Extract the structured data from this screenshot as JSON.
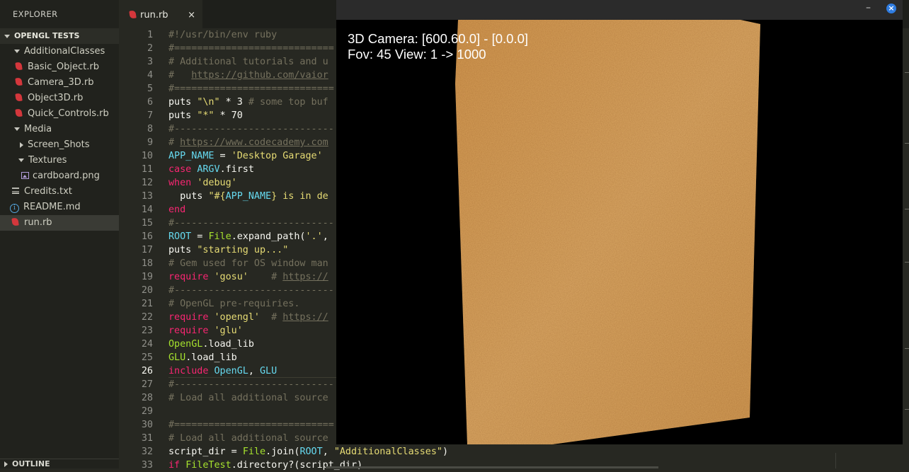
{
  "sidebar": {
    "header": "EXPLORER",
    "project": "OPENGL TESTS",
    "outline": "OUTLINE",
    "items": [
      {
        "label": "AdditionalClasses",
        "kind": "folder-open"
      },
      {
        "label": "Basic_Object.rb",
        "kind": "ruby"
      },
      {
        "label": "Camera_3D.rb",
        "kind": "ruby"
      },
      {
        "label": "Object3D.rb",
        "kind": "ruby"
      },
      {
        "label": "Quick_Controls.rb",
        "kind": "ruby"
      },
      {
        "label": "Media",
        "kind": "folder-open"
      },
      {
        "label": "Screen_Shots",
        "kind": "folder-closed"
      },
      {
        "label": "Textures",
        "kind": "folder-open"
      },
      {
        "label": "cardboard.png",
        "kind": "image"
      },
      {
        "label": "Credits.txt",
        "kind": "text"
      },
      {
        "label": "README.md",
        "kind": "info"
      },
      {
        "label": "run.rb",
        "kind": "ruby",
        "selected": true
      }
    ]
  },
  "tab": {
    "label": "run.rb",
    "close": "×"
  },
  "editor": {
    "line_numbers": [
      "1",
      "2",
      "3",
      "4",
      "5",
      "6",
      "7",
      "8",
      "9",
      "10",
      "11",
      "12",
      "13",
      "14",
      "15",
      "16",
      "17",
      "18",
      "19",
      "20",
      "21",
      "22",
      "23",
      "24",
      "25",
      "26",
      "27",
      "28",
      "29",
      "30",
      "31",
      "32",
      "33"
    ],
    "active_line": "26",
    "lines": [
      [
        [
          "c-com",
          "#!/usr/bin/env ruby"
        ]
      ],
      [
        [
          "c-com",
          "#============================"
        ]
      ],
      [
        [
          "c-com",
          "# Additional tutorials and u"
        ]
      ],
      [
        [
          "c-com",
          "#   "
        ],
        [
          "c-link",
          "https://github.com/vaior"
        ]
      ],
      [
        [
          "c-com",
          "#============================"
        ]
      ],
      [
        [
          "c-pl",
          "puts "
        ],
        [
          "c-str",
          "\"\\n\""
        ],
        [
          "c-pl",
          " * 3 "
        ],
        [
          "c-com",
          "# some top buf"
        ]
      ],
      [
        [
          "c-pl",
          "puts "
        ],
        [
          "c-str",
          "\"*\""
        ],
        [
          "c-pl",
          " * 70"
        ]
      ],
      [
        [
          "c-com",
          "#----------------------------"
        ]
      ],
      [
        [
          "c-com",
          "# "
        ],
        [
          "c-link",
          "https://www.codecademy.com"
        ]
      ],
      [
        [
          "c-const",
          "APP_NAME"
        ],
        [
          "c-pl",
          " = "
        ],
        [
          "c-str",
          "'Desktop Garage'"
        ]
      ],
      [
        [
          "c-key",
          "case"
        ],
        [
          "c-pl",
          " "
        ],
        [
          "c-const",
          "ARGV"
        ],
        [
          "c-pl",
          ".first"
        ]
      ],
      [
        [
          "c-key",
          "when"
        ],
        [
          "c-pl",
          " "
        ],
        [
          "c-str",
          "'debug'"
        ]
      ],
      [
        [
          "c-pl",
          "  puts "
        ],
        [
          "c-str",
          "\"#{"
        ],
        [
          "c-const",
          "APP_NAME"
        ],
        [
          "c-str",
          "} is in de"
        ]
      ],
      [
        [
          "c-key",
          "end"
        ]
      ],
      [
        [
          "c-com",
          "#----------------------------"
        ]
      ],
      [
        [
          "c-const",
          "ROOT"
        ],
        [
          "c-pl",
          " = "
        ],
        [
          "c-cls",
          "File"
        ],
        [
          "c-pl",
          ".expand_path("
        ],
        [
          "c-str",
          "'.'"
        ],
        [
          "c-pl",
          ","
        ]
      ],
      [
        [
          "c-pl",
          "puts "
        ],
        [
          "c-str",
          "\"starting up...\""
        ]
      ],
      [
        [
          "c-com",
          "# Gem used for OS window man"
        ]
      ],
      [
        [
          "c-key",
          "require"
        ],
        [
          "c-pl",
          " "
        ],
        [
          "c-str",
          "'gosu'"
        ],
        [
          "c-pl",
          "    "
        ],
        [
          "c-com",
          "# "
        ],
        [
          "c-link",
          "https://"
        ]
      ],
      [
        [
          "c-com",
          "#----------------------------"
        ]
      ],
      [
        [
          "c-com",
          "# OpenGL pre-requiries."
        ]
      ],
      [
        [
          "c-key",
          "require"
        ],
        [
          "c-pl",
          " "
        ],
        [
          "c-str",
          "'opengl'"
        ],
        [
          "c-pl",
          "  "
        ],
        [
          "c-com",
          "# "
        ],
        [
          "c-link",
          "https://"
        ]
      ],
      [
        [
          "c-key",
          "require"
        ],
        [
          "c-pl",
          " "
        ],
        [
          "c-str",
          "'glu'"
        ]
      ],
      [
        [
          "c-cls",
          "OpenGL"
        ],
        [
          "c-pl",
          ".load_lib"
        ]
      ],
      [
        [
          "c-cls",
          "GLU"
        ],
        [
          "c-pl",
          ".load_lib"
        ]
      ],
      [
        [
          "c-key",
          "include"
        ],
        [
          "c-pl",
          " "
        ],
        [
          "c-const",
          "OpenGL"
        ],
        [
          "c-pl",
          ", "
        ],
        [
          "c-const",
          "GLU"
        ]
      ],
      [
        [
          "c-com",
          "#----------------------------"
        ]
      ],
      [
        [
          "c-com",
          "# Load all additional source"
        ]
      ],
      [
        [
          "c-pl",
          ""
        ]
      ],
      [
        [
          "c-com",
          "#============================"
        ]
      ],
      [
        [
          "c-com",
          "# Load all additional source"
        ]
      ],
      [
        [
          "c-pl",
          "script_dir = "
        ],
        [
          "c-cls",
          "File"
        ],
        [
          "c-pl",
          ".join("
        ],
        [
          "c-const",
          "ROOT"
        ],
        [
          "c-pl",
          ", "
        ],
        [
          "c-str",
          "\"AdditionalClasses\""
        ],
        [
          "c-pl",
          ")"
        ]
      ],
      [
        [
          "c-key",
          "if"
        ],
        [
          "c-pl",
          " "
        ],
        [
          "c-cls",
          "FileTest"
        ],
        [
          "c-pl",
          ".directory?(script_dir)"
        ]
      ]
    ]
  },
  "game_window": {
    "minimize": "–",
    "close": "×",
    "hud_line1": "3D Camera: [600.60.0] - [0.0.0]",
    "hud_line2": "Fov: 45 View: 1 -> 1000",
    "texture_color": "#d9a35a"
  }
}
